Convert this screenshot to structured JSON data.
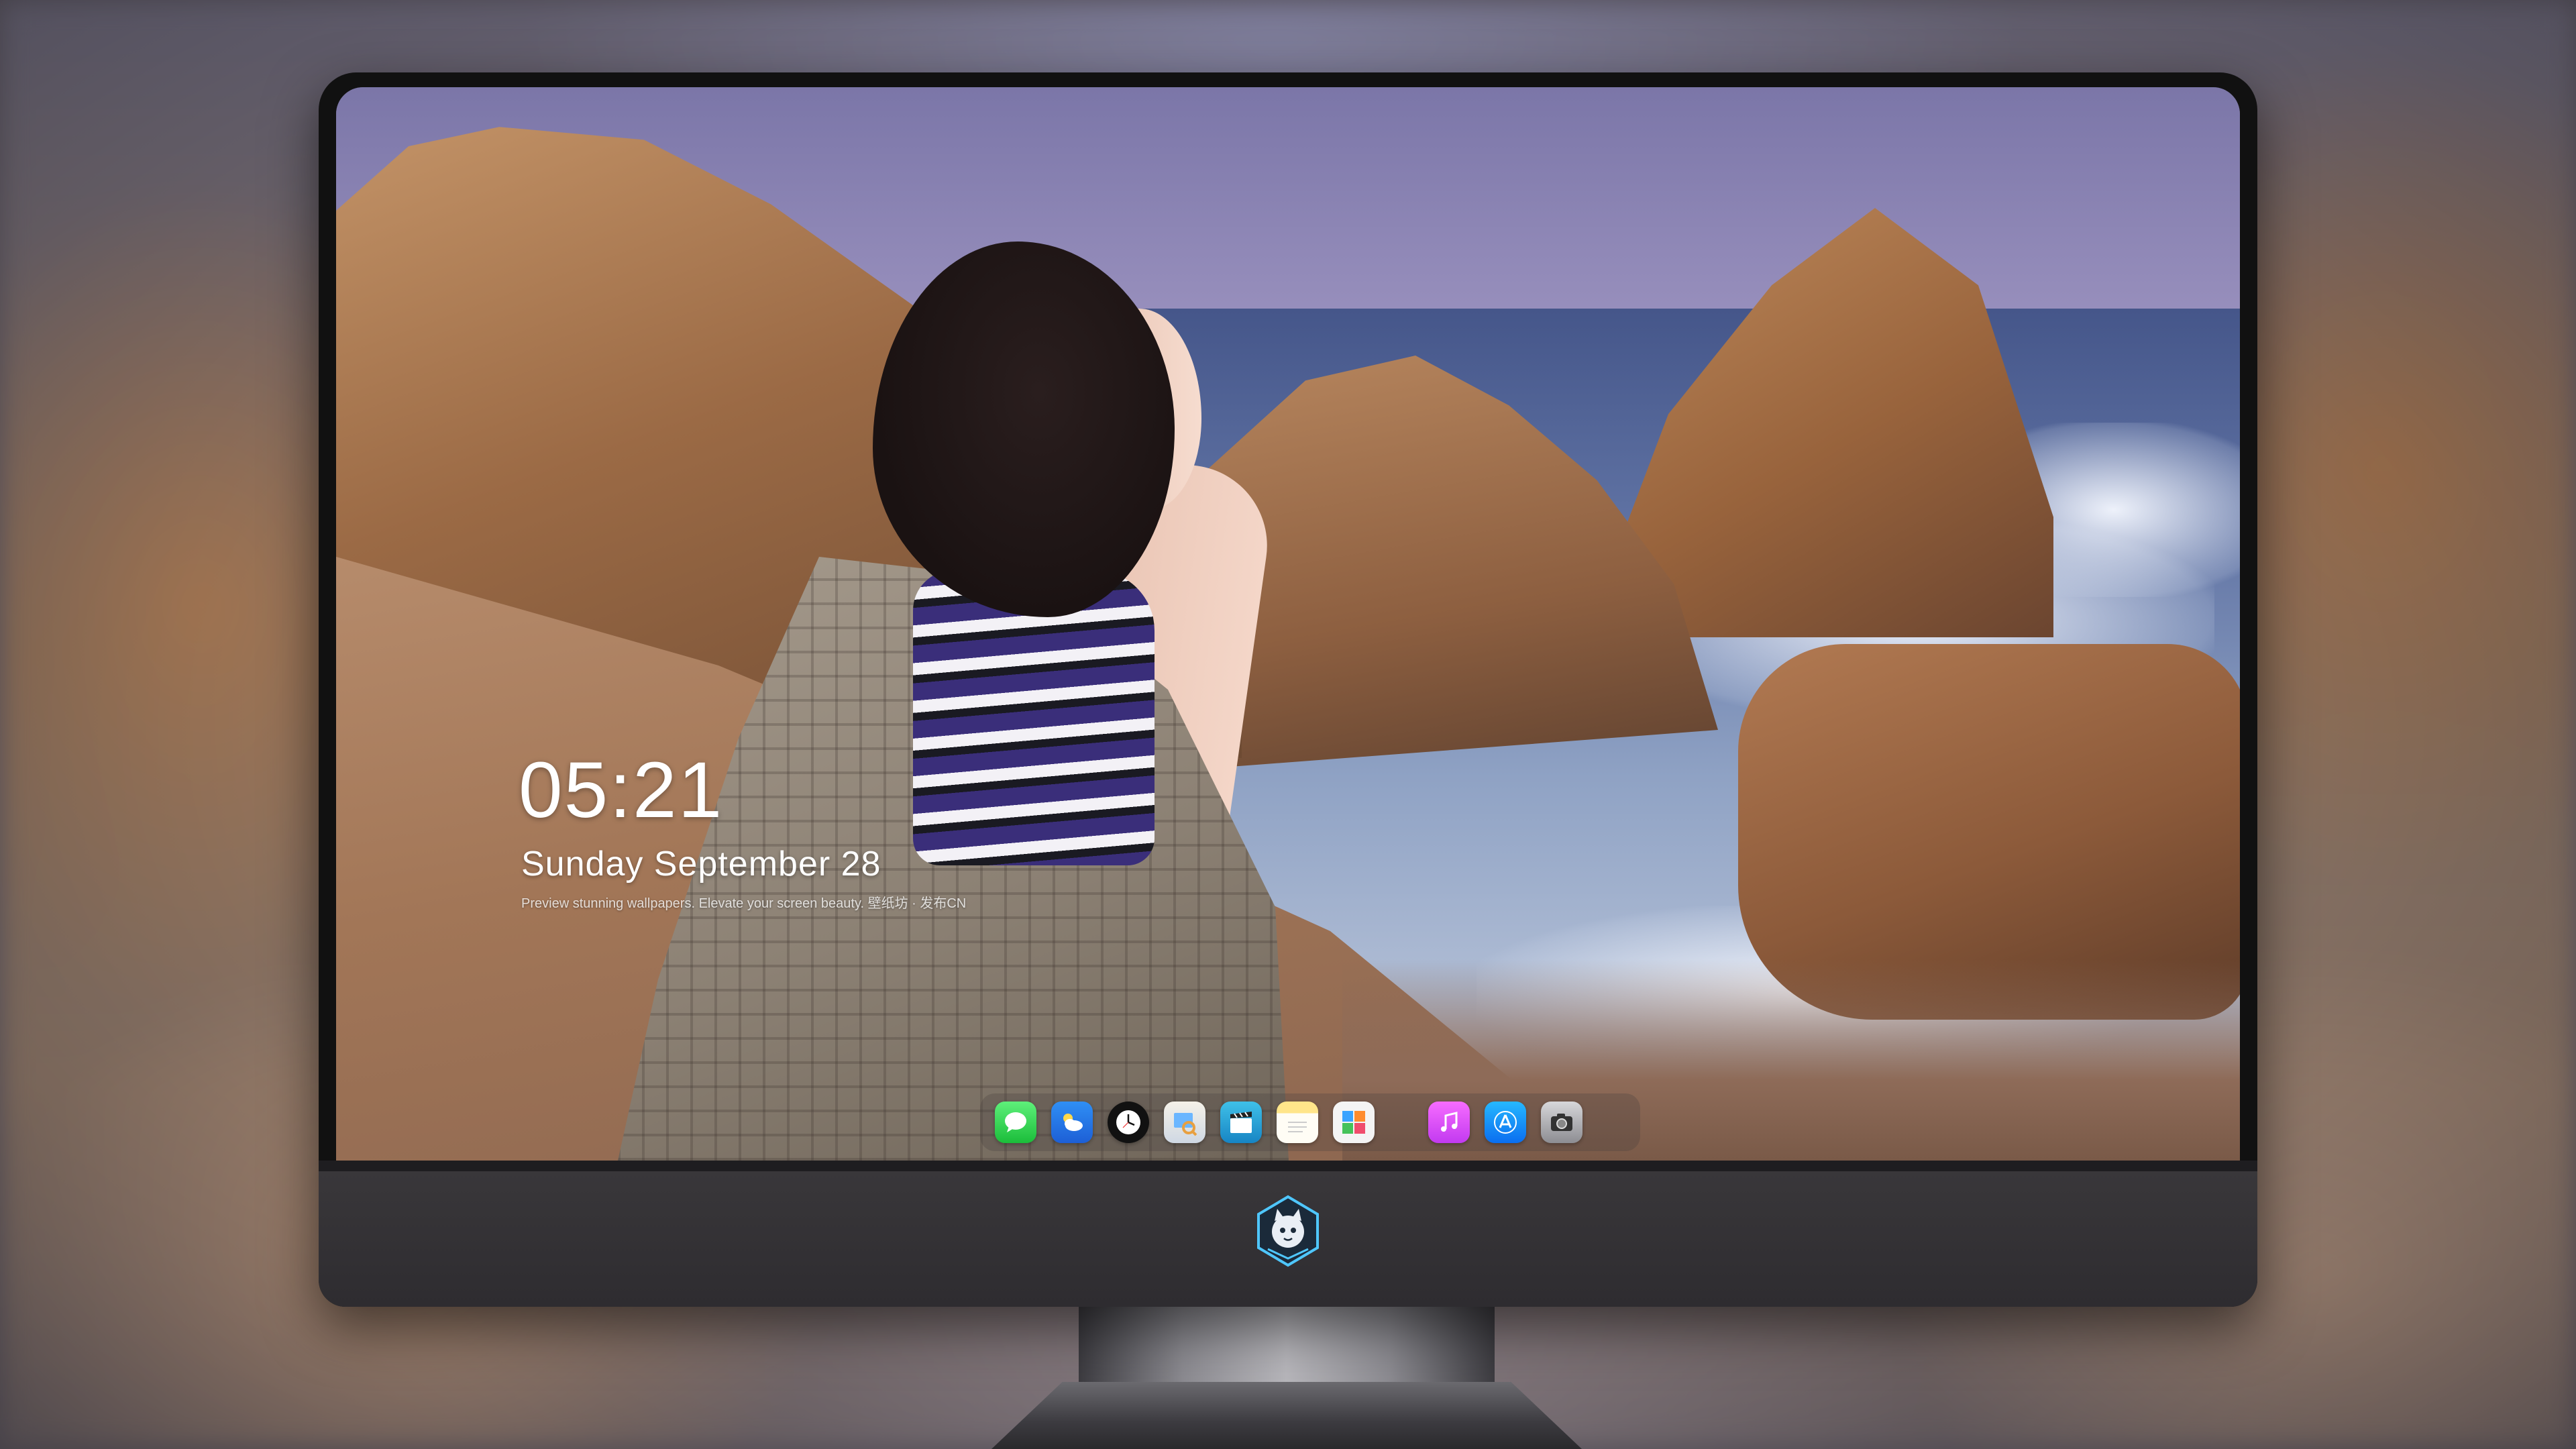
{
  "lock_screen": {
    "time": "05:21",
    "date": "Sunday September 28",
    "tagline": "Preview stunning wallpapers. Elevate your screen beauty. 壁纸坊 · 发布CN"
  },
  "dock": {
    "apps": [
      {
        "name": "Messages",
        "icon": "message-bubble-icon"
      },
      {
        "name": "Weather",
        "icon": "cloud-sun-icon"
      },
      {
        "name": "Clock",
        "icon": "clock-icon"
      },
      {
        "name": "Preview",
        "icon": "preview-icon"
      },
      {
        "name": "Video Editor",
        "icon": "clapperboard-icon"
      },
      {
        "name": "Notes",
        "icon": "notes-icon"
      },
      {
        "name": "Photos",
        "icon": "photo-grid-icon"
      },
      {
        "name": "Music",
        "icon": "music-note-icon"
      },
      {
        "name": "App Store",
        "icon": "app-store-icon"
      },
      {
        "name": "Camera",
        "icon": "camera-icon"
      }
    ]
  },
  "monitor": {
    "logo_icon": "cat-mascot-badge-icon",
    "bezel_color": "#111111",
    "chin_color": "#333135"
  },
  "colors": {
    "sky": "#8d87b8",
    "sea": "#4f608f",
    "rock": "#a8744c"
  }
}
